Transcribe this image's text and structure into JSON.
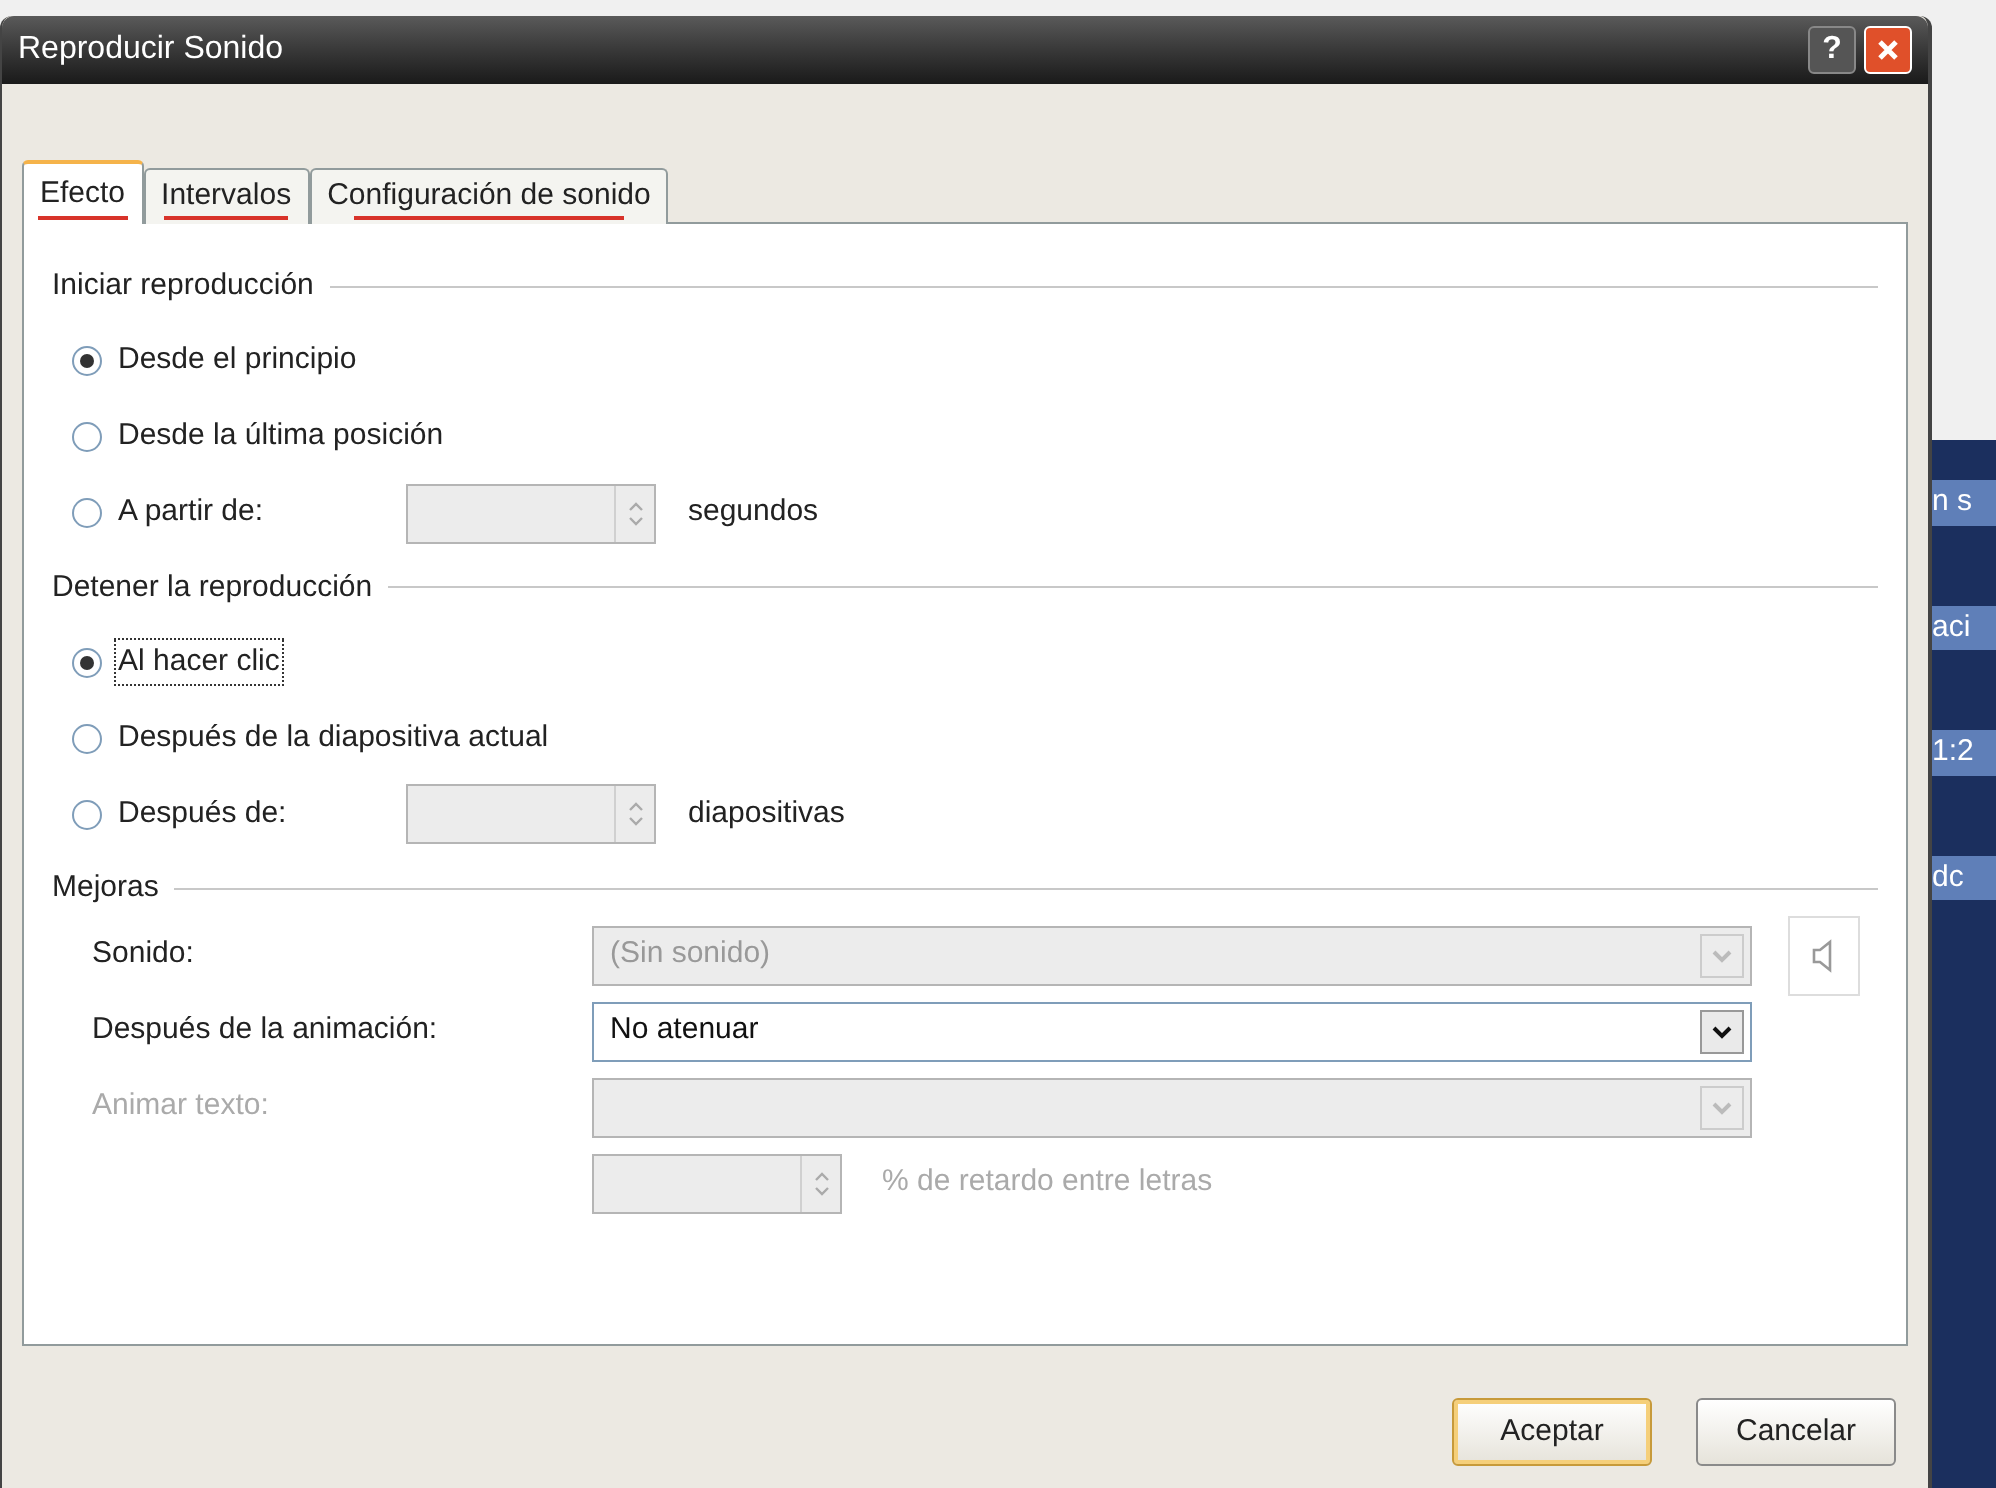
{
  "window": {
    "title": "Reproducir Sonido",
    "help_button": "?"
  },
  "tabs": [
    {
      "label": "Efecto",
      "selected": true,
      "marked": true
    },
    {
      "label": "Intervalos",
      "selected": false,
      "marked": true
    },
    {
      "label": "Configuración de sonido",
      "selected": false,
      "marked": true
    }
  ],
  "sections": [
    {
      "title": "Iniciar reproducción",
      "options": [
        {
          "kind": "plain",
          "label": "Desde el principio",
          "selected": true,
          "focused": false
        },
        {
          "kind": "plain",
          "label": "Desde la última posición",
          "selected": false,
          "focused": false
        },
        {
          "kind": "spin",
          "label": "A partir de:",
          "selected": false,
          "focused": false,
          "suffix": "segundos"
        }
      ]
    },
    {
      "title": "Detener la reproducción",
      "options": [
        {
          "kind": "plain",
          "label": "Al hacer clic",
          "selected": true,
          "focused": true
        },
        {
          "kind": "plain",
          "label": "Después de la diapositiva actual",
          "selected": false,
          "focused": false
        },
        {
          "kind": "spin",
          "label": "Después de:",
          "selected": false,
          "focused": false,
          "suffix": "diapositivas"
        }
      ]
    }
  ],
  "enhancements": {
    "title": "Mejoras",
    "rows": [
      {
        "kind": "combo",
        "label": "Sonido:",
        "value": "(Sin sonido)",
        "disabled": true,
        "speaker": true
      },
      {
        "kind": "combo",
        "label": "Después de la animación:",
        "value": "No atenuar",
        "disabled": false,
        "speaker": false
      },
      {
        "kind": "combo",
        "label": "Animar texto:",
        "disabled": true,
        "speaker": false
      },
      {
        "kind": "spin",
        "suffix": "% de retardo entre letras",
        "disabled": true
      }
    ]
  },
  "buttons": [
    {
      "label": "Aceptar",
      "default": true
    },
    {
      "label": "Cancelar",
      "default": false
    }
  ],
  "background_window": {
    "texts": [
      "n s",
      "aci",
      "1:2",
      "dc"
    ]
  }
}
